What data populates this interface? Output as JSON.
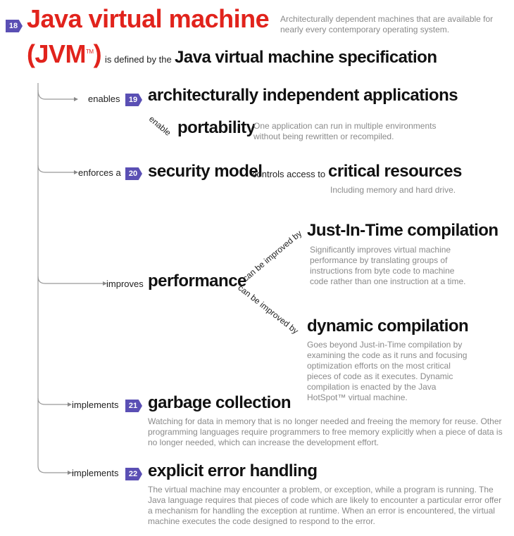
{
  "colors": {
    "accent": "#e1231c",
    "badge": "#5a4fb4",
    "line": "#999999",
    "desc": "#8a8a8a"
  },
  "header": {
    "badge": "18",
    "title_line1": "Java virtual machine",
    "title_line2": "(JVM",
    "tm": "TM",
    "title_close": ")",
    "description": "Architecturally dependent machines that are available for nearly every contemporary operating system.",
    "defined_by": "is defined by the",
    "spec": "Java virtual machine specification"
  },
  "branches": {
    "apps": {
      "verb": "enables",
      "badge": "19",
      "label": "architecturally independent applications"
    },
    "portability": {
      "verb": "enable",
      "label": "portability",
      "description": "One application can run in multiple environments without being rewritten or recompiled."
    },
    "security": {
      "verb": "enforces a",
      "badge": "20",
      "label": "security model",
      "connector": "controls access to",
      "target": "critical resources",
      "description": "Including memory and hard drive."
    },
    "performance": {
      "verb": "improves",
      "label": "performance",
      "jit_verb": "can be improved by",
      "jit_label": "Just-In-Time compilation",
      "jit_description": "Significantly improves virtual machine performance by translating groups of instructions from byte code to machine code rather than one instruction at a time.",
      "dyn_verb": "can be improved by",
      "dyn_label": "dynamic compilation",
      "dyn_description": "Goes beyond Just-in-Time compilation by examining the code as it runs and focusing optimization efforts on the most critical pieces of code as it executes. Dynamic compilation is enacted by the Java HotSpot™ virtual machine."
    },
    "gc": {
      "verb": "implements",
      "badge": "21",
      "label": "garbage collection",
      "description": "Watching for data in memory that is no longer needed and freeing the memory for reuse. Other programming languages require programmers to free memory explicitly when a piece of data is no longer needed, which can increase the development effort."
    },
    "errors": {
      "verb": "implements",
      "badge": "22",
      "label": "explicit error handling",
      "description": "The virtual machine may encounter a problem, or exception, while a program is running. The Java language requires that pieces of code which are likely to encounter a particular error offer a mechanism for handling the exception at runtime. When an error is encountered, the virtual machine executes the code designed to respond to the error."
    }
  }
}
